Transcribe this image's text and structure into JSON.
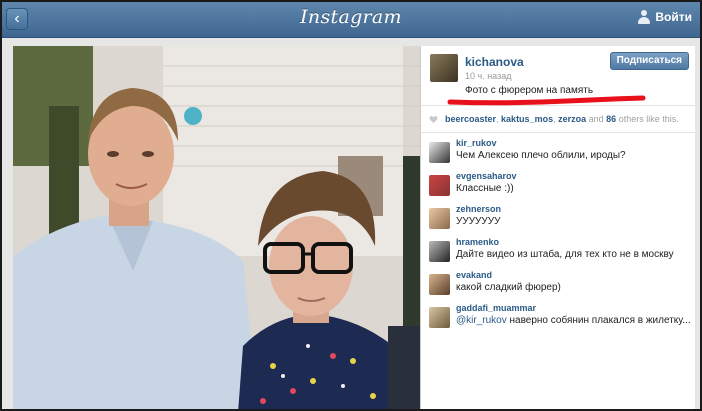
{
  "topbar": {
    "logo": "Instagram",
    "login_label": "Войти"
  },
  "post": {
    "owner": {
      "username": "kichanova",
      "time": "10 ч. назад",
      "caption": "Фото с фюрером на память"
    },
    "follow_label": "Подписаться",
    "likes": {
      "users": [
        "beercoaster",
        "kaktus_mos",
        "zerzoa"
      ],
      "text_and": "and",
      "count": "86",
      "text_suffix": "others like this."
    },
    "comments": [
      {
        "username": "kir_rukov",
        "text": "Чем Алексею плечо облили, ироды?"
      },
      {
        "username": "evgensaharov",
        "text": "Классные :))"
      },
      {
        "username": "zehnerson",
        "text": "УУУУУУУ"
      },
      {
        "username": "hramenko",
        "text": "Дайте видео из штаба, для тех кто не в москву"
      },
      {
        "username": "evakand",
        "text": "какой сладкий фюрер)"
      },
      {
        "username": "gaddafi_muammar",
        "mention": "@kir_rukov",
        "text": " наверно собянин плакался в жилетку..."
      }
    ]
  },
  "colors": {
    "topbar": "#4a7299",
    "username": "#2b5a87",
    "annotation": "#e8101a"
  }
}
